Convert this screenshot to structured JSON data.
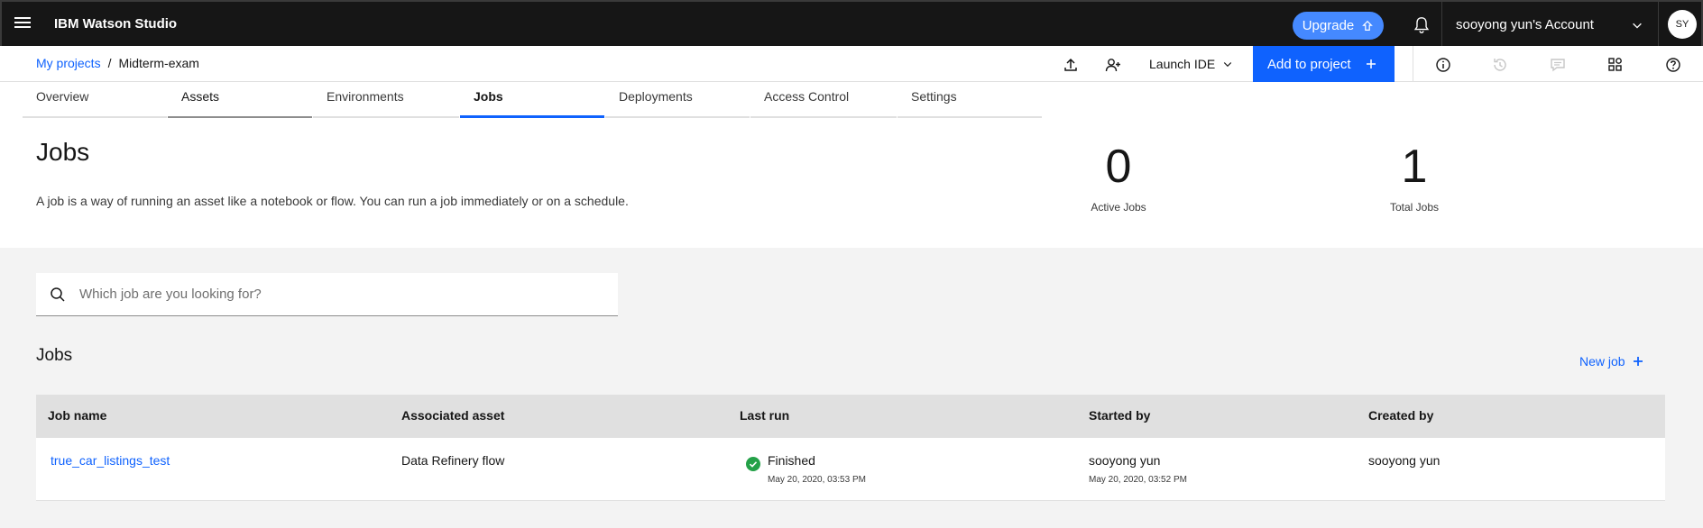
{
  "topbar": {
    "brand": "IBM Watson Studio",
    "upgrade_label": "Upgrade",
    "account_label": "sooyong yun's Account",
    "avatar_initials": "SY"
  },
  "breadcrumb": {
    "root": "My projects",
    "separator": "/",
    "current": "Midterm-exam"
  },
  "toolbar": {
    "launch_ide_label": "Launch IDE",
    "add_project_label": "Add to project"
  },
  "tabs": [
    {
      "label": "Overview"
    },
    {
      "label": "Assets"
    },
    {
      "label": "Environments"
    },
    {
      "label": "Jobs"
    },
    {
      "label": "Deployments"
    },
    {
      "label": "Access Control"
    },
    {
      "label": "Settings"
    }
  ],
  "header": {
    "title": "Jobs",
    "description": "A job is a way of running an asset like a notebook or flow. You can run a job immediately or on a schedule.",
    "active_jobs_count": "0",
    "active_jobs_label": "Active Jobs",
    "total_jobs_count": "1",
    "total_jobs_label": "Total Jobs"
  },
  "search": {
    "placeholder": "Which job are you looking for?"
  },
  "jobs_section": {
    "title": "Jobs",
    "new_job_label": "New job"
  },
  "table": {
    "columns": [
      "Job name",
      "Associated asset",
      "Last run",
      "Started by",
      "Created by"
    ],
    "rows": [
      {
        "job_name": "true_car_listings_test",
        "asset": "Data Refinery flow",
        "last_run_status": "Finished",
        "last_run_time": "May 20, 2020, 03:53 PM",
        "started_by": "sooyong yun",
        "started_time": "May 20, 2020, 03:52 PM",
        "created_by": "sooyong yun"
      }
    ]
  },
  "colors": {
    "primary": "#0f62fe",
    "upgrade": "#4589ff",
    "success": "#24a148",
    "topbar": "#161616"
  }
}
